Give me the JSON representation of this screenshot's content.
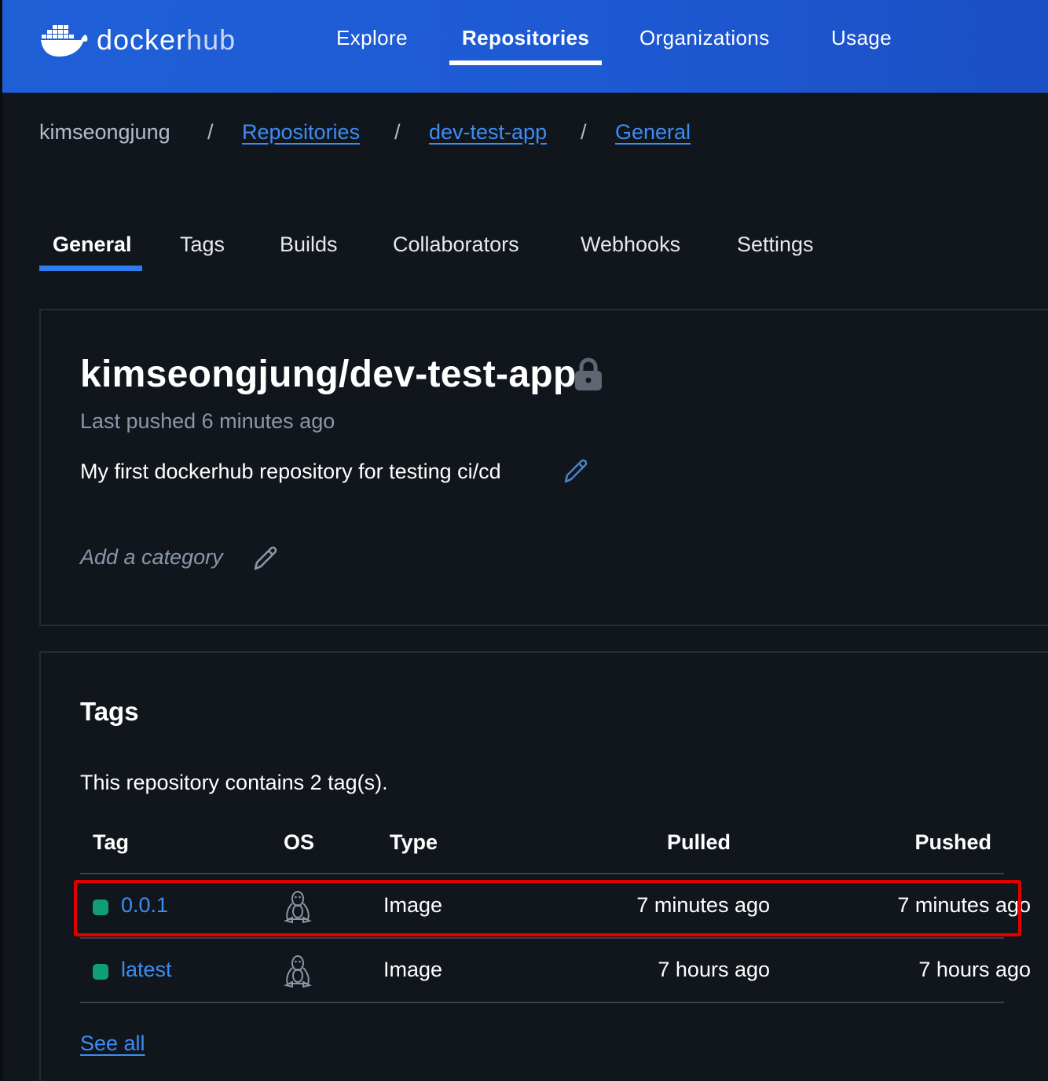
{
  "brand": {
    "docker": "docker",
    "hub": "hub"
  },
  "nav": {
    "items": [
      {
        "label": "Explore"
      },
      {
        "label": "Repositories"
      },
      {
        "label": "Organizations"
      },
      {
        "label": "Usage"
      }
    ],
    "active": "Repositories"
  },
  "breadcrumb": {
    "items": [
      "kimseongjung",
      "Repositories",
      "dev-test-app",
      "General"
    ],
    "separator": "/"
  },
  "tabs": {
    "items": [
      "General",
      "Tags",
      "Builds",
      "Collaborators",
      "Webhooks",
      "Settings"
    ],
    "active": "General"
  },
  "repo": {
    "title": "kimseongjung/dev-test-app",
    "visibility_icon": "lock-icon",
    "last_pushed": "Last pushed 6 minutes ago",
    "description": "My first dockerhub repository for testing ci/cd",
    "category_placeholder": "Add a category"
  },
  "tags_section": {
    "heading": "Tags",
    "summary": "This repository contains 2 tag(s).",
    "columns": [
      "Tag",
      "OS",
      "Type",
      "Pulled",
      "Pushed"
    ],
    "rows": [
      {
        "tag": "0.0.1",
        "os_icon": "linux-tux-icon",
        "type": "Image",
        "pulled": "7 minutes ago",
        "pushed": "7 minutes ago",
        "highlighted": true
      },
      {
        "tag": "latest",
        "os_icon": "linux-tux-icon",
        "type": "Image",
        "pulled": "7 hours ago",
        "pushed": "7 hours ago",
        "highlighted": false
      }
    ],
    "see_all": "See all"
  },
  "colors": {
    "nav_bg": "#1f5fd6",
    "page_bg": "#11161c",
    "link": "#3d8df5",
    "active_tab_underline": "#2f7cf0",
    "status_dot": "#0e9f74",
    "highlight_border": "#e00000"
  }
}
